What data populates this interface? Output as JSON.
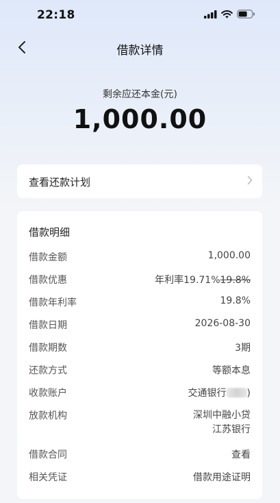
{
  "status_bar": {
    "time": "22:18"
  },
  "nav": {
    "title": "借款详情"
  },
  "summary": {
    "label": "剩余应还本金(元)",
    "amount": "1,000.00"
  },
  "plan": {
    "label": "查看还款计划"
  },
  "details": {
    "title": "借款明细",
    "rows": {
      "amount": {
        "label": "借款金额",
        "value": "1,000.00"
      },
      "discount": {
        "label": "借款优惠",
        "value": "年利率19.71%",
        "original": "19.8%"
      },
      "rate": {
        "label": "借款年利率",
        "value": "19.8%"
      },
      "date": {
        "label": "借款日期",
        "value": "2026-08-30"
      },
      "terms": {
        "label": "借款期数",
        "value": "3期"
      },
      "method": {
        "label": "还款方式",
        "value": "等额本息"
      },
      "account": {
        "label": "收款账户",
        "value_prefix": "交通银行",
        "value_suffix": ")"
      },
      "lender": {
        "label": "放款机构",
        "value_line1": "深圳中融小贷",
        "value_line2": "江苏银行"
      },
      "contract": {
        "label": "借款合同",
        "value": "查看"
      },
      "voucher": {
        "label": "相关凭证",
        "value": "借款用途证明"
      }
    }
  },
  "colors": {
    "accent_orange": "#e8712b",
    "link_blue": "#3b6fd8"
  }
}
